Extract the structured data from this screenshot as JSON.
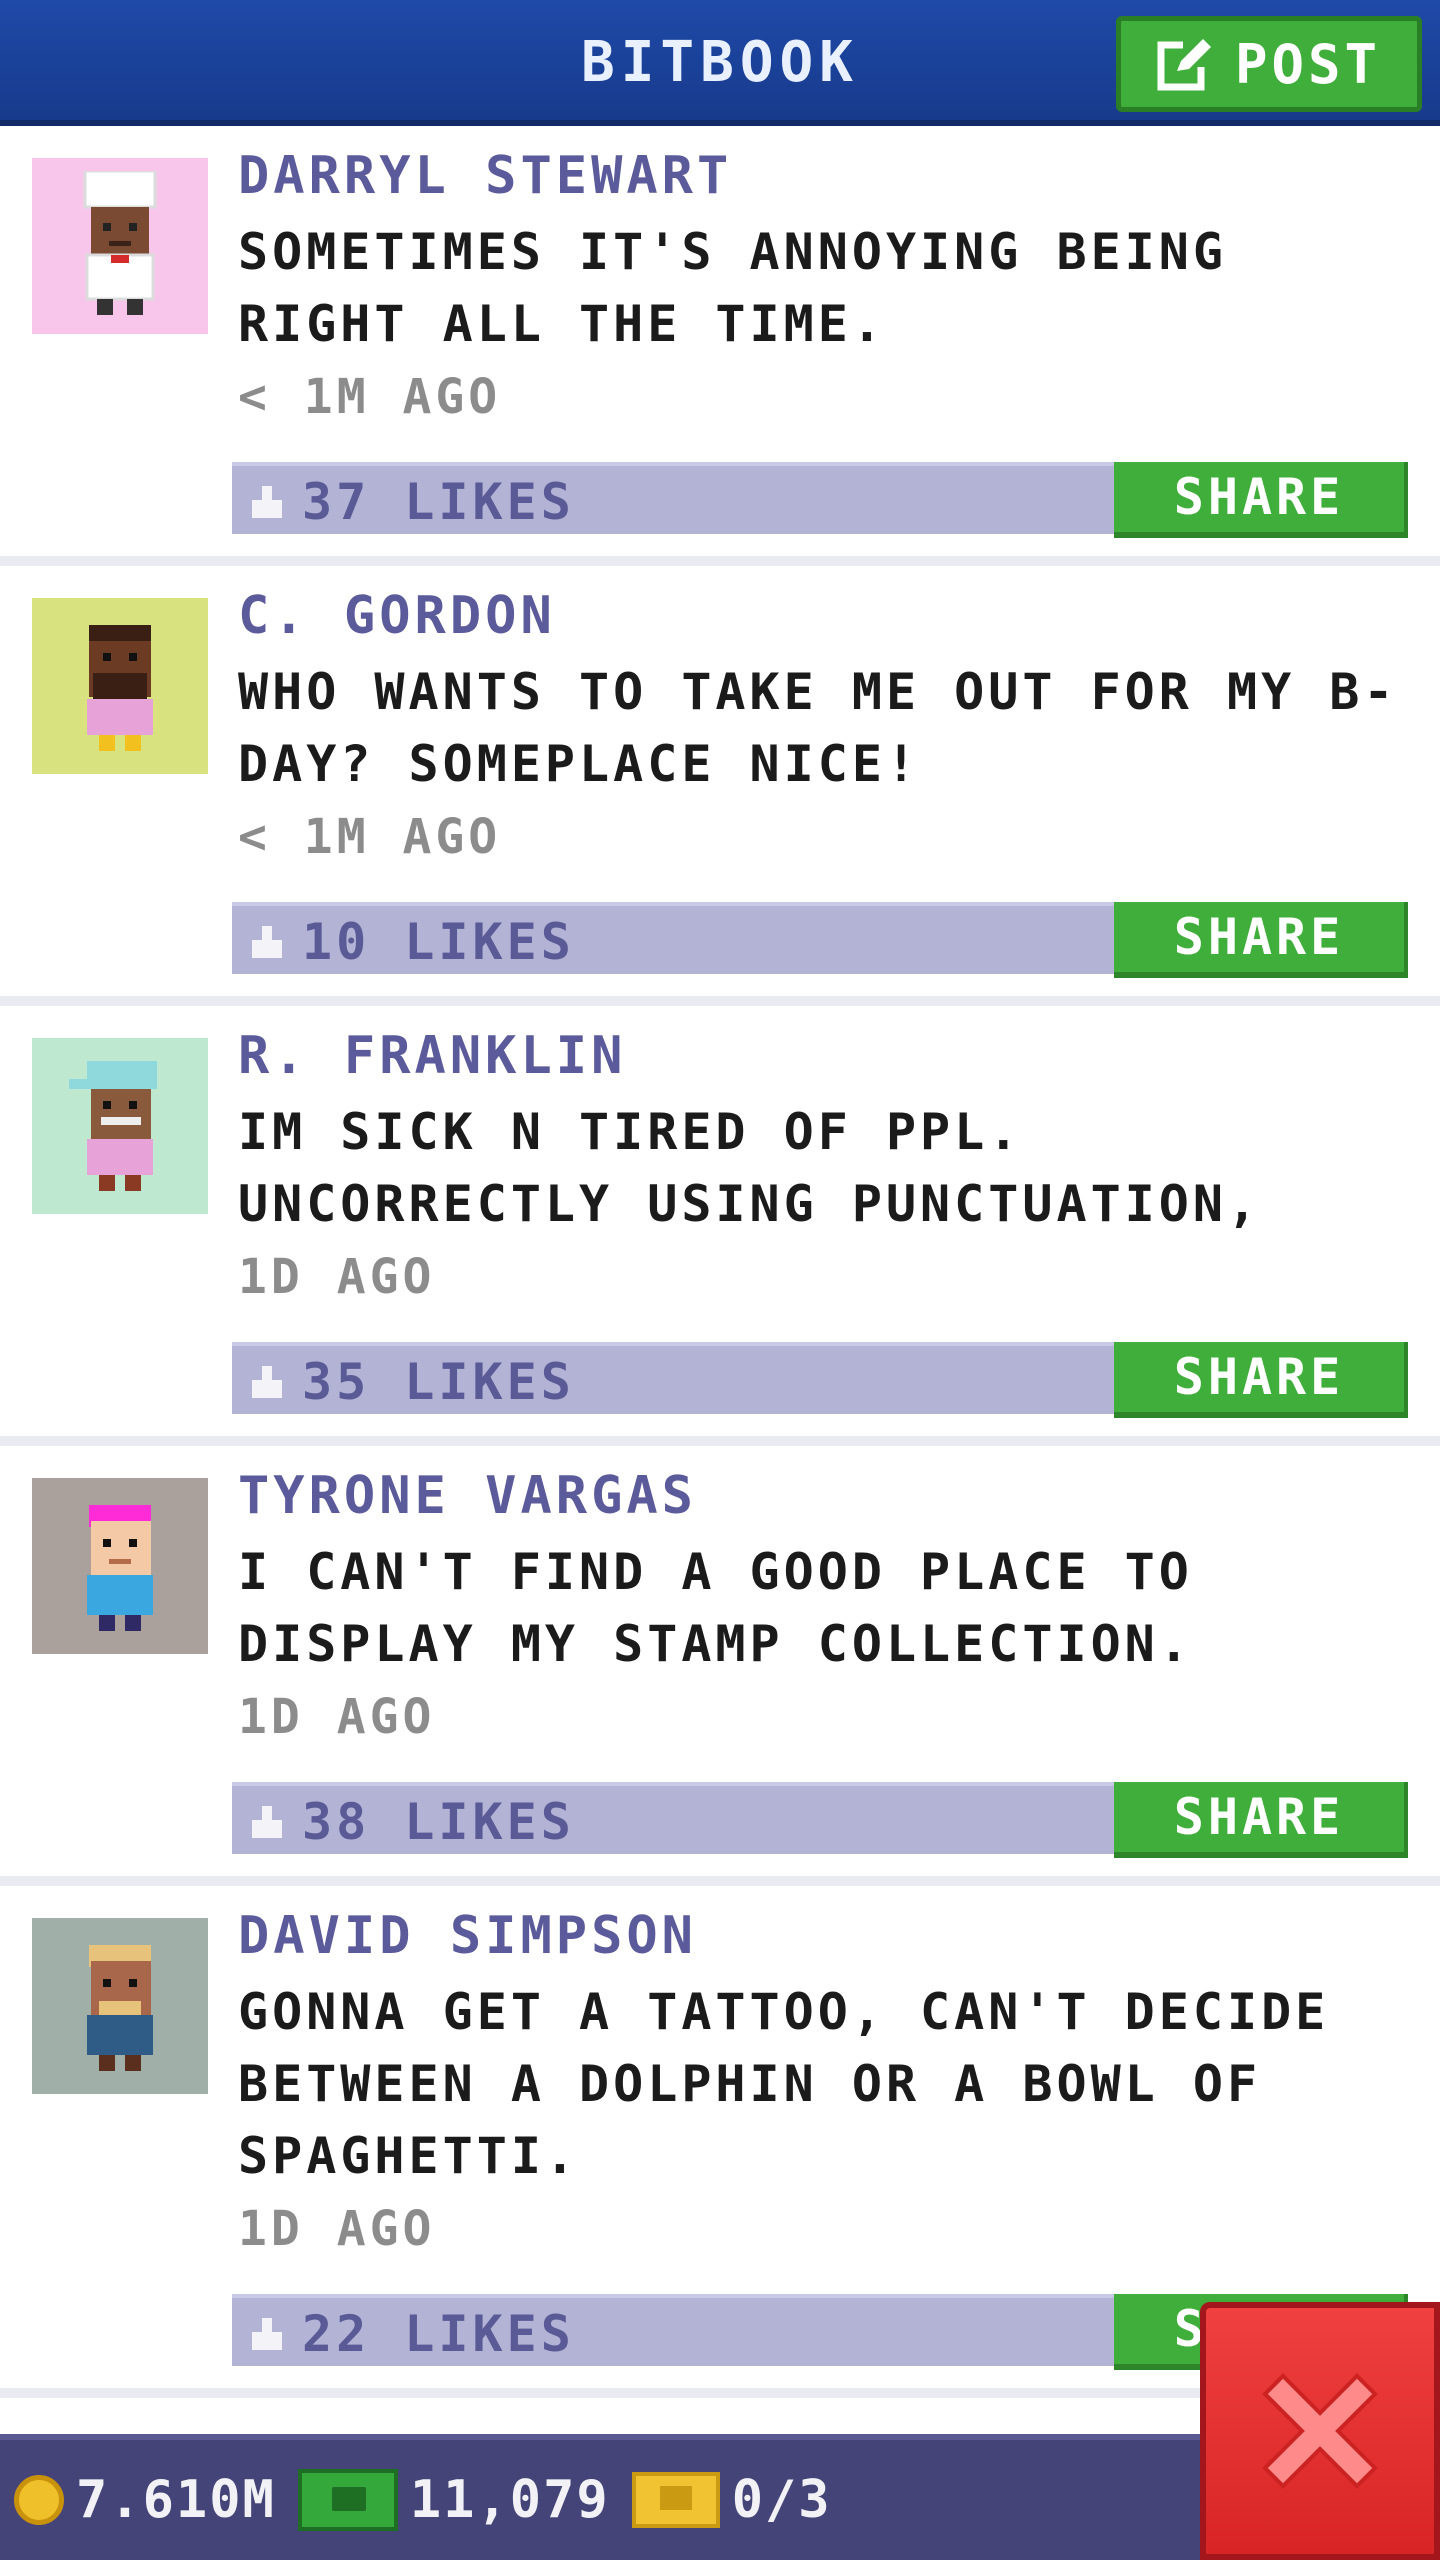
{
  "header": {
    "title": "BITBOOK",
    "post_label": "POST"
  },
  "colors": {
    "accent": "#1f4aa8",
    "button_green": "#3fae3a",
    "like_bar": "#b3b3d6",
    "close_red": "#e43030"
  },
  "posts": [
    {
      "author": "DARRYL STEWART",
      "message": "SOMETIMES IT'S ANNOYING BEING RIGHT ALL THE TIME.",
      "time": "< 1M AGO",
      "likes": "37 LIKES",
      "share": "SHARE",
      "avatar_icon": "chef-avatar",
      "avatar_bg": "#f8c6ea"
    },
    {
      "author": "C. GORDON",
      "message": "WHO WANTS TO TAKE ME OUT FOR MY B-DAY? SOMEPLACE NICE!",
      "time": "< 1M AGO",
      "likes": "10 LIKES",
      "share": "SHARE",
      "avatar_icon": "bearded-avatar",
      "avatar_bg": "#d8e37f"
    },
    {
      "author": "R. FRANKLIN",
      "message": "IM SICK N TIRED OF PPL. UNCORRECTLY USING PUNCTUATION,",
      "time": "1D AGO",
      "likes": "35 LIKES",
      "share": "SHARE",
      "avatar_icon": "cap-avatar",
      "avatar_bg": "#bfe8d0"
    },
    {
      "author": "TYRONE VARGAS",
      "message": "I CAN'T FIND A GOOD PLACE TO DISPLAY MY STAMP COLLECTION.",
      "time": "1D AGO",
      "likes": "38 LIKES",
      "share": "SHARE",
      "avatar_icon": "pink-hair-avatar",
      "avatar_bg": "#aaa19d"
    },
    {
      "author": "DAVID SIMPSON",
      "message": "GONNA GET A TATTOO, CAN'T DECIDE BETWEEN A DOLPHIN OR A BOWL OF SPAGHETTI.",
      "time": "1D AGO",
      "likes": "22 LIKES",
      "share": "SHARE",
      "avatar_icon": "blond-avatar",
      "avatar_bg": "#a0afa8"
    }
  ],
  "footer": {
    "coins": "7.610M",
    "bux": "11,079",
    "tickets": "0/3"
  }
}
